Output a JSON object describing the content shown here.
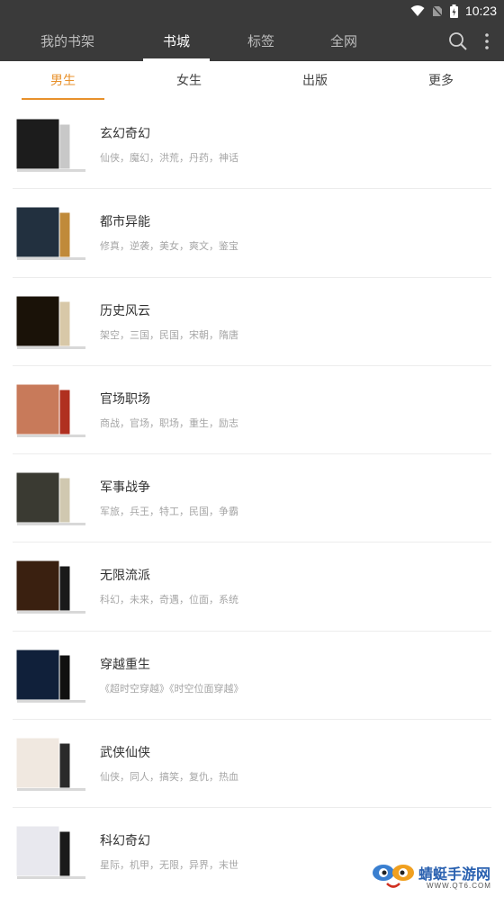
{
  "status_bar": {
    "time": "10:23",
    "icons": [
      "wifi-icon",
      "no-sim-icon",
      "battery-charging-icon"
    ]
  },
  "top_tabs": [
    {
      "label": "我的书架",
      "active": false
    },
    {
      "label": "书城",
      "active": true
    },
    {
      "label": "标签",
      "active": false
    },
    {
      "label": "全网",
      "active": false
    }
  ],
  "app_actions": [
    "search-icon",
    "more-vert-icon"
  ],
  "sub_tabs": [
    {
      "label": "男生",
      "active": true
    },
    {
      "label": "女生",
      "active": false
    },
    {
      "label": "出版",
      "active": false
    },
    {
      "label": "更多",
      "active": false
    }
  ],
  "categories": [
    {
      "title": "玄幻奇幻",
      "tags": "仙侠，魔幻，洪荒，丹药，神话"
    },
    {
      "title": "都市异能",
      "tags": "修真，逆袭，美女，爽文，鉴宝"
    },
    {
      "title": "历史风云",
      "tags": "架空，三国，民国，宋朝，隋唐"
    },
    {
      "title": "官场职场",
      "tags": "商战，官场，职场，重生，励志"
    },
    {
      "title": "军事战争",
      "tags": "军旅，兵王，特工，民国，争霸"
    },
    {
      "title": "无限流派",
      "tags": "科幻，未来，奇遇，位面，系统"
    },
    {
      "title": "穿越重生",
      "tags": "《超时空穿越》《时空位面穿越》"
    },
    {
      "title": "武侠仙侠",
      "tags": "仙侠，同人，搞笑，复仇，热血"
    },
    {
      "title": "科幻奇幻",
      "tags": "星际，机甲，无限，异界，末世"
    }
  ],
  "cover_colors": [
    [
      "#1c1c1c",
      "#3b3b3b",
      "#c8c8c8"
    ],
    [
      "#22303f",
      "#5a3a2a",
      "#c08a3a"
    ],
    [
      "#1a1208",
      "#5b1e12",
      "#d8c8a8"
    ],
    [
      "#c87a5a",
      "#e8d0b8",
      "#b03020"
    ],
    [
      "#3a3a32",
      "#202020",
      "#d0c8b0"
    ],
    [
      "#3a2010",
      "#c0302a",
      "#1a1a1a"
    ],
    [
      "#10203a",
      "#3a5aa0",
      "#101010"
    ],
    [
      "#f0e8e0",
      "#c02010",
      "#2a2a2a"
    ],
    [
      "#e8e8ee",
      "#6a7a90",
      "#1a1a1a"
    ]
  ],
  "watermark": {
    "text": "蜻蜓手游网",
    "url": "WWW.QT6.COM"
  }
}
